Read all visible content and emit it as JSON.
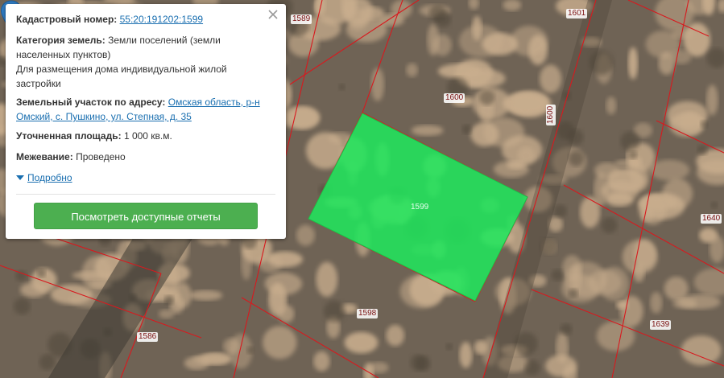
{
  "map": {
    "colors": {
      "ground": "#6f6355",
      "sand": "#c9ae8e",
      "boundary": "#d8191e",
      "selected_parcel": "#1ee85c",
      "marker": "#2f7cc4"
    },
    "parcel_labels": [
      "1589",
      "1601",
      "1600",
      "1600",
      "1599",
      "1640",
      "1598",
      "1586",
      "1639"
    ],
    "selected_parcel_label": "1599",
    "marker_icon": "map-pin-icon"
  },
  "popup": {
    "cadastral_label": "Кадастровый номер:",
    "cadastral_value": "55:20:191202:1599",
    "category_label": "Категория земель:",
    "category_value": "Земли поселений (земли населенных пунктов)",
    "permitted_use": "Для размещения дома индивидуальной жилой застройки",
    "address_label": "Земельный участок по адресу:",
    "address_value": "Омская область, р-н Омский, с. Пушкино, ул. Степная, д. 35",
    "area_label": "Уточненная площадь:",
    "area_value": "1 000 кв.м.",
    "survey_label": "Межевание:",
    "survey_value": "Проведено",
    "more_link": "Подробно",
    "report_button": "Посмотреть доступные отчеты",
    "close_icon": "close-icon"
  }
}
